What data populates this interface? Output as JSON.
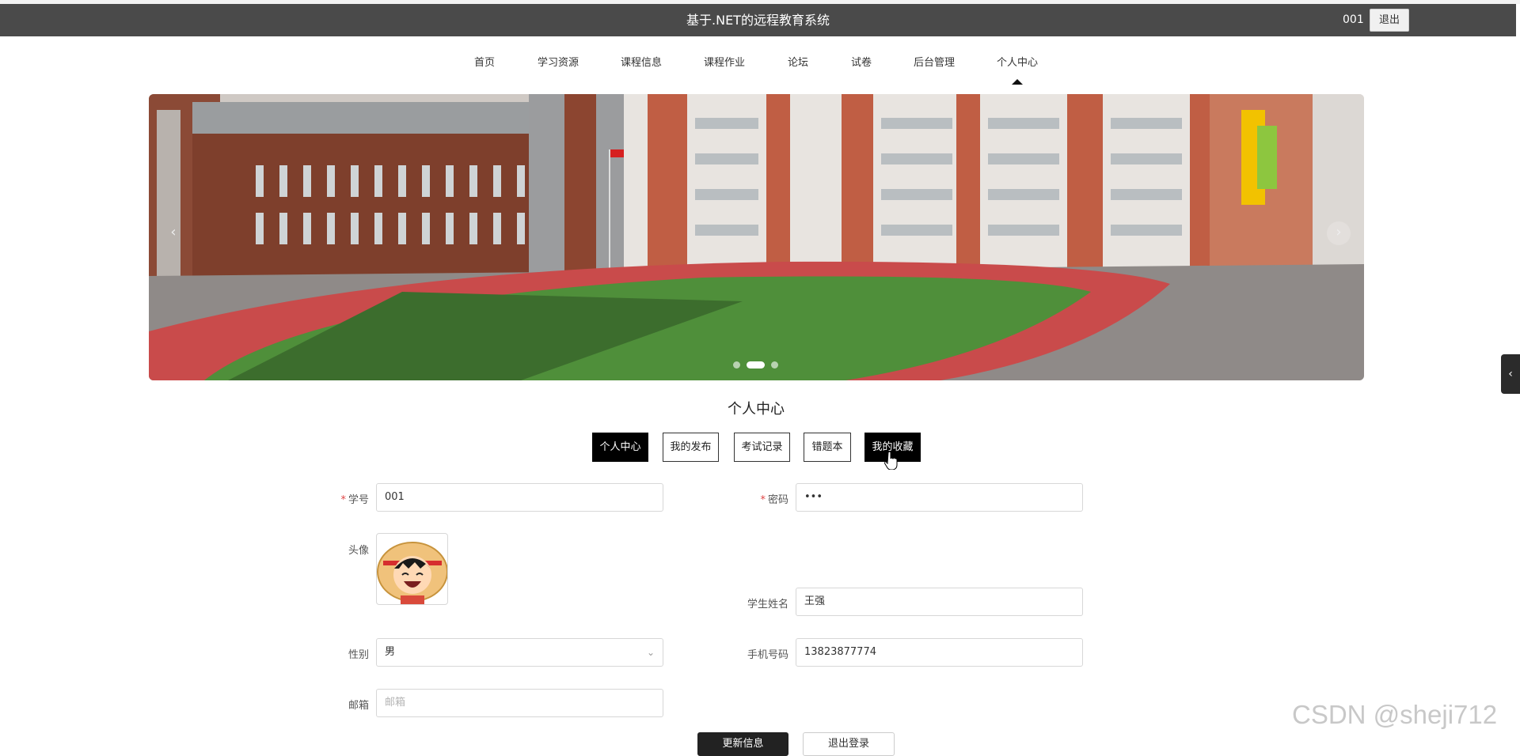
{
  "header": {
    "title": "基于.NET的远程教育系统",
    "user": "001",
    "logout_label": "退出"
  },
  "nav": {
    "items": [
      {
        "label": "首页"
      },
      {
        "label": "学习资源"
      },
      {
        "label": "课程信息"
      },
      {
        "label": "课程作业"
      },
      {
        "label": "论坛"
      },
      {
        "label": "试卷"
      },
      {
        "label": "后台管理"
      },
      {
        "label": "个人中心"
      }
    ],
    "active": "个人中心"
  },
  "carousel": {
    "image": "campus-sports-field",
    "prev_icon": "chevron-left-icon",
    "next_icon": "chevron-right-icon",
    "slide_count": 3,
    "active_slide": 2
  },
  "section_title": "个人中心",
  "tabs": [
    {
      "label": "个人中心",
      "active": true
    },
    {
      "label": "我的发布",
      "active": false
    },
    {
      "label": "考试记录",
      "active": false
    },
    {
      "label": "错题本",
      "active": false
    },
    {
      "label": "我的收藏",
      "active": true
    }
  ],
  "form": {
    "student_id": {
      "label": "学号",
      "value": "001",
      "required": true
    },
    "password": {
      "label": "密码",
      "value": "•••",
      "required": true
    },
    "avatar": {
      "label": "头像"
    },
    "student_name": {
      "label": "学生姓名",
      "value": "王强"
    },
    "gender": {
      "label": "性别",
      "value": "男"
    },
    "phone": {
      "label": "手机号码",
      "value": "13823877774"
    },
    "email": {
      "label": "邮箱",
      "placeholder": "邮箱",
      "value": ""
    }
  },
  "buttons": {
    "update": "更新信息",
    "logout": "退出登录"
  },
  "watermark": "CSDN @sheji712",
  "colors": {
    "topbar": "#4a4a4a",
    "active_tab": "#000000",
    "required": "#e04545"
  }
}
